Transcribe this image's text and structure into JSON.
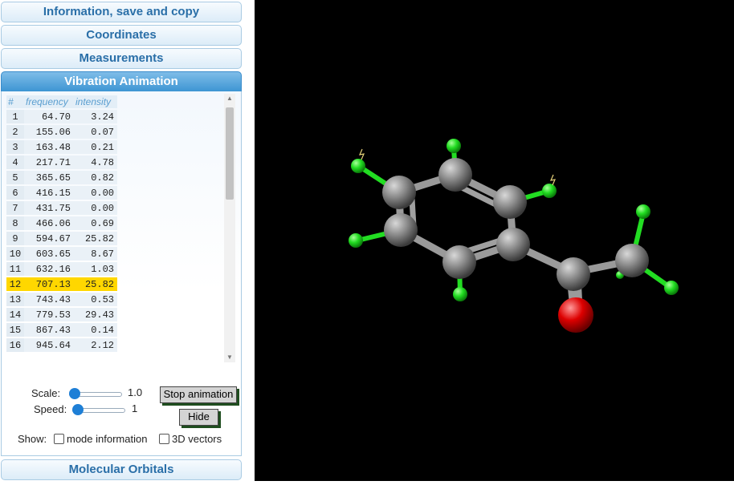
{
  "sections": {
    "info": "Information, save and copy",
    "coordinates": "Coordinates",
    "measurements": "Measurements",
    "vibration": "Vibration Animation",
    "orbitals": "Molecular Orbitals"
  },
  "table": {
    "headers": {
      "num": "#",
      "frequency": "frequency",
      "intensity": "intensity"
    },
    "rows": [
      {
        "n": "1",
        "f": "64.70",
        "i": "3.24"
      },
      {
        "n": "2",
        "f": "155.06",
        "i": "0.07"
      },
      {
        "n": "3",
        "f": "163.48",
        "i": "0.21"
      },
      {
        "n": "4",
        "f": "217.71",
        "i": "4.78"
      },
      {
        "n": "5",
        "f": "365.65",
        "i": "0.82"
      },
      {
        "n": "6",
        "f": "416.15",
        "i": "0.00"
      },
      {
        "n": "7",
        "f": "431.75",
        "i": "0.00"
      },
      {
        "n": "8",
        "f": "466.06",
        "i": "0.69"
      },
      {
        "n": "9",
        "f": "594.67",
        "i": "25.82"
      },
      {
        "n": "10",
        "f": "603.65",
        "i": "8.67"
      },
      {
        "n": "11",
        "f": "632.16",
        "i": "1.03"
      },
      {
        "n": "12",
        "f": "707.13",
        "i": "25.82"
      },
      {
        "n": "13",
        "f": "743.43",
        "i": "0.53"
      },
      {
        "n": "14",
        "f": "779.53",
        "i": "29.43"
      },
      {
        "n": "15",
        "f": "867.43",
        "i": "0.14"
      },
      {
        "n": "16",
        "f": "945.64",
        "i": "2.12"
      }
    ],
    "selected_row": "12"
  },
  "controls": {
    "scale_label": "Scale:",
    "scale_value": "1.0",
    "speed_label": "Speed:",
    "speed_value": "1",
    "stop_button": "Stop animation",
    "hide_button": "Hide",
    "show_label": "Show:",
    "mode_info": "mode information",
    "vectors": "3D vectors",
    "mode_info_checked": false,
    "vectors_checked": false
  },
  "colors": {
    "accent": "#3d95d3",
    "selected_row": "#ffd700",
    "carbon": "#808080",
    "hydrogen": "#22dd22",
    "oxygen": "#dd0000"
  }
}
